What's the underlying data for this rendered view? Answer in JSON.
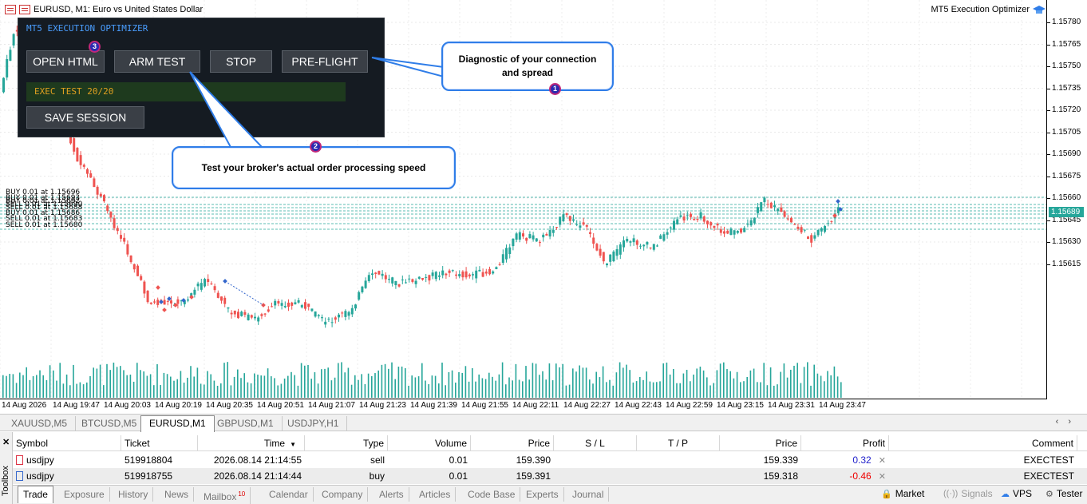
{
  "chart": {
    "title": "EURUSD, M1:  Euro vs United States Dollar",
    "ea_name": "MT5 Execution Optimizer",
    "current_price": "1.15689",
    "price_ticks": [
      "1.15780",
      "1.15765",
      "1.15750",
      "1.15735",
      "1.15720",
      "1.15705",
      "1.15690",
      "1.15675",
      "1.15660",
      "1.15645",
      "1.15630",
      "1.15615"
    ],
    "time_ticks": [
      "14 Aug 2026",
      "14 Aug 19:47",
      "14 Aug 20:03",
      "14 Aug 20:19",
      "14 Aug 20:35",
      "14 Aug 20:51",
      "14 Aug 21:07",
      "14 Aug 21:23",
      "14 Aug 21:39",
      "14 Aug 21:55",
      "14 Aug 22:11",
      "14 Aug 22:27",
      "14 Aug 22:43",
      "14 Aug 22:59",
      "14 Aug 23:15",
      "14 Aug 23:31",
      "14 Aug 23:47"
    ],
    "order_labels": [
      "BUY 0.01 at 1.15696",
      "BUY 0.01 at 1.15693",
      "BUY 0.01 at 1.15692",
      "SELL 0.01 at 1.15690",
      "SELL 0.01 at 1.15688",
      "BUY 0.01 at 1.15686",
      "SELL 0.01 at 1.15683",
      "SELL 0.01 at 1.15680"
    ]
  },
  "ea_panel": {
    "title": "MT5 EXECUTION OPTIMIZER",
    "buttons": {
      "open_html": "OPEN HTML",
      "arm_test": "ARM TEST",
      "stop": "STOP",
      "pre_flight": "PRE-FLIGHT",
      "save_session": "SAVE SESSION"
    },
    "status": "EXEC TEST 20/20"
  },
  "callouts": [
    {
      "number": "1",
      "text_line1": "Diagnostic of your connection",
      "text_line2": "and spread"
    },
    {
      "number": "2",
      "text": "Test your broker's actual order processing speed"
    },
    {
      "number": "3"
    }
  ],
  "symbol_tabs": [
    "XAUUSD,M5",
    "BTCUSD,M5",
    "EURUSD,M1",
    "GBPUSD,M1",
    "USDJPY,H1"
  ],
  "active_symbol_tab": "EURUSD,M1",
  "toolbox": {
    "side_label": "Toolbox",
    "columns": [
      "Symbol",
      "Ticket",
      "Time",
      "Type",
      "Volume",
      "Price",
      "S / L",
      "T / P",
      "Price",
      "Profit",
      "Comment"
    ],
    "time_sort_indicator": "▼",
    "rows": [
      {
        "symbol": "usdjpy",
        "ticket": "519918804",
        "time": "2026.08.14 21:14:55",
        "type": "sell",
        "volume": "0.01",
        "price": "159.390",
        "sl": "",
        "tp": "",
        "cur_price": "159.339",
        "profit": "0.32",
        "comment": "EXECTEST"
      },
      {
        "symbol": "usdjpy",
        "ticket": "519918755",
        "time": "2026.08.14 21:14:44",
        "type": "buy",
        "volume": "0.01",
        "price": "159.391",
        "sl": "",
        "tp": "",
        "cur_price": "159.318",
        "profit": "-0.46",
        "comment": "EXECTEST"
      }
    ],
    "tabs": [
      "Trade",
      "Exposure",
      "History",
      "News",
      "Mailbox",
      "Calendar",
      "Company",
      "Alerts",
      "Articles",
      "Code Base",
      "Experts",
      "Journal"
    ],
    "mailbox_count": "10",
    "right_buttons": {
      "market": "Market",
      "signals": "Signals",
      "vps": "VPS",
      "tester": "Tester"
    }
  },
  "colors": {
    "bull": "#26a69a",
    "bear": "#ef5350",
    "panel_bg": "#151b22",
    "panel_title": "#4a9eff",
    "status_text": "#e0a020",
    "callout_border": "#2f7de8"
  }
}
